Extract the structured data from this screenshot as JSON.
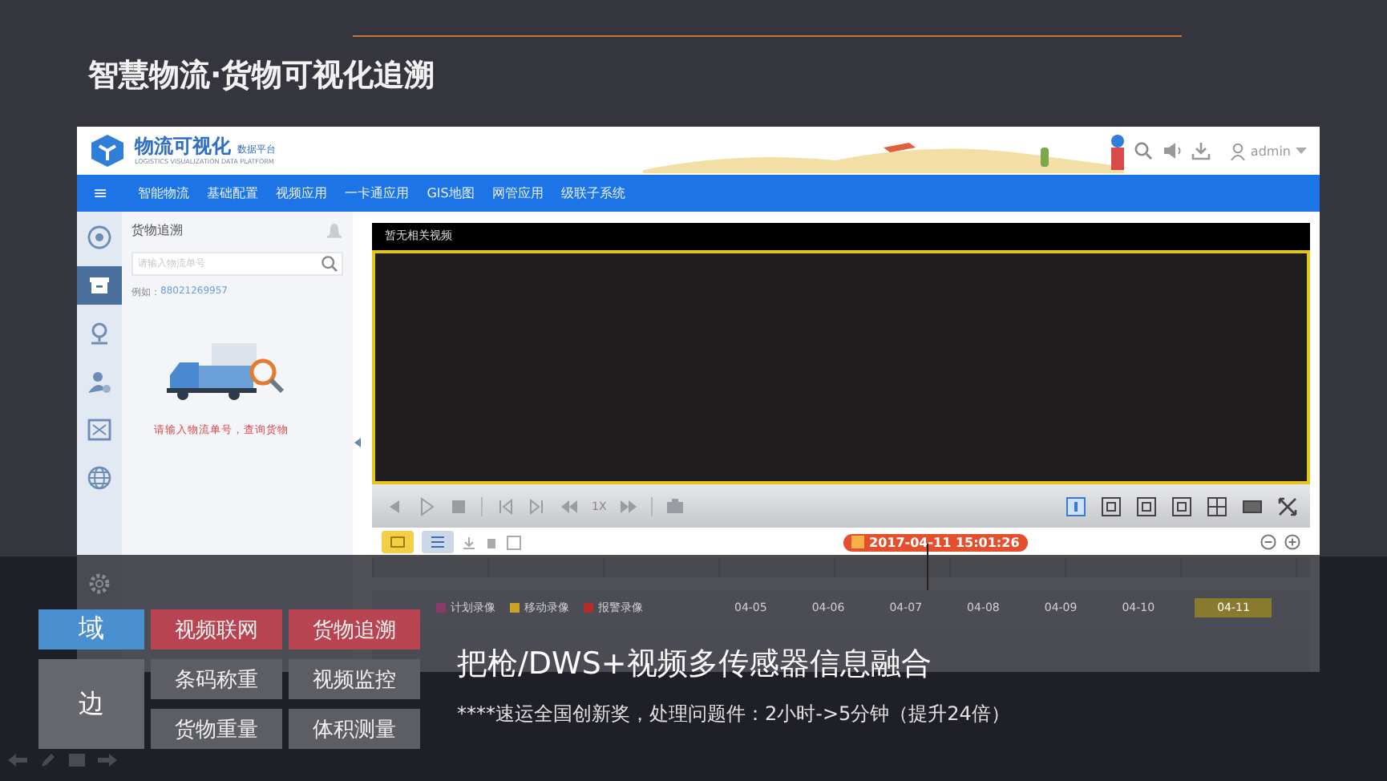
{
  "slide_title": "智慧物流·货物可视化追溯",
  "header": {
    "logo_title": "物流可视化",
    "logo_badge": "数据平台",
    "logo_subtitle": "LOGISTICS VISUALIZATION DATA PLATFORM",
    "user": "admin"
  },
  "nav": {
    "menu_icon": "≡",
    "items": [
      {
        "label": "智能物流"
      },
      {
        "label": "基础配置"
      },
      {
        "label": "视频应用"
      },
      {
        "label": "一卡通应用"
      },
      {
        "label": "GIS地图"
      },
      {
        "label": "网管应用"
      },
      {
        "label": "级联子系统"
      }
    ]
  },
  "rail": [
    {
      "kind": "target",
      "selected": false
    },
    {
      "kind": "box",
      "selected": true
    },
    {
      "kind": "pin",
      "selected": false
    },
    {
      "kind": "person",
      "selected": false
    },
    {
      "kind": "film",
      "selected": false
    },
    {
      "kind": "globe",
      "selected": false
    },
    {
      "kind": "gear",
      "selected": false
    }
  ],
  "panel": {
    "title": "货物追溯",
    "search_placeholder": "请输入物流单号",
    "example_label": "例如：",
    "example_value": "88021269957",
    "hint": "请输入物流单号，查询货物"
  },
  "video": {
    "title": "暂无相关视频",
    "speed": "1X",
    "timestamp": "2017-04-11 15:01:26",
    "legend": [
      {
        "label": "计划录像",
        "color": "#8a3a6a"
      },
      {
        "label": "移动录像",
        "color": "#c9a227"
      },
      {
        "label": "报警录像",
        "color": "#b52a2a"
      }
    ],
    "dates": [
      {
        "label": "04-05",
        "selected": false
      },
      {
        "label": "04-06",
        "selected": false
      },
      {
        "label": "04-07",
        "selected": false
      },
      {
        "label": "04-08",
        "selected": false
      },
      {
        "label": "04-09",
        "selected": false
      },
      {
        "label": "04-10",
        "selected": false
      },
      {
        "label": "04-11",
        "selected": true
      }
    ]
  },
  "overlay": {
    "domains": [
      {
        "label": "域",
        "color": "#4a8fd0"
      },
      {
        "label": "边",
        "color": "#66676d"
      }
    ],
    "tags": [
      {
        "label": "视频联网",
        "color": "#b84452"
      },
      {
        "label": "货物追溯",
        "color": "#b84452"
      },
      {
        "label": "条码称重",
        "color": "#5d5e64"
      },
      {
        "label": "视频监控",
        "color": "#5d5e64"
      },
      {
        "label": "货物重量",
        "color": "#5d5e64"
      },
      {
        "label": "体积测量",
        "color": "#5d5e64"
      }
    ],
    "headline": "把枪/DWS+视频多传感器信息融合",
    "subline": "****速运全国创新奖，处理问题件：2小时->5分钟（提升24倍）"
  }
}
